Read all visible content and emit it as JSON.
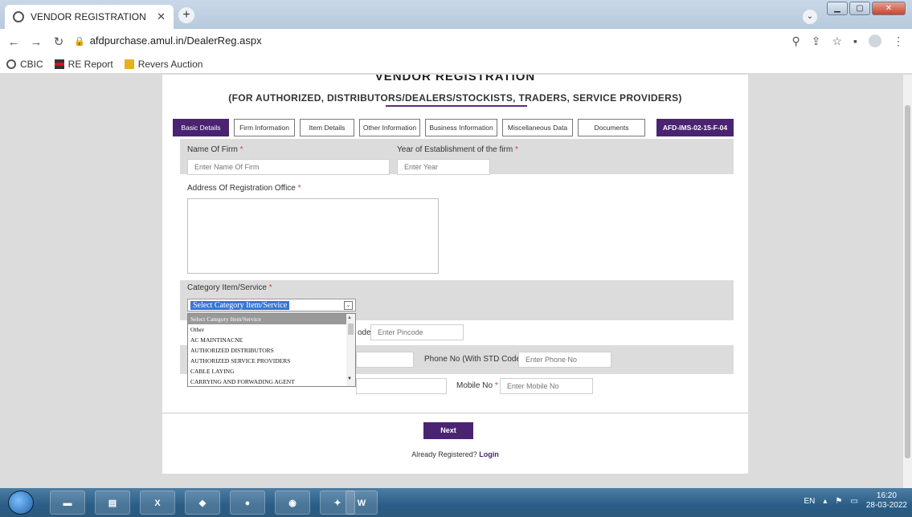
{
  "browser": {
    "tab_title": "VENDOR REGISTRATION",
    "new_tab": "+",
    "url": "afdpurchase.amul.in/DealerReg.aspx",
    "bookmarks": [
      "CBIC",
      "RE Report",
      "Revers Auction"
    ]
  },
  "page": {
    "title": "VENDOR REGISTRATION",
    "subtitle": "(FOR AUTHORIZED, DISTRIBUTORS/DEALERS/STOCKISTS, TRADERS, SERVICE PROVIDERS)",
    "tabs": [
      "Basic Details",
      "Firm Information",
      "Item Details",
      "Other Information",
      "Business Information",
      "Miscellaneous Data",
      "Documents"
    ],
    "form_code": "AFD-IMS-02-15-F-04",
    "form": {
      "name_label": "Name Of Firm",
      "name_placeholder": "Enter Name Of Firm",
      "year_label": "Year of Establishment of the firm",
      "year_placeholder": "Enter Year",
      "address_label": "Address Of Registration Office",
      "category_label": "Category Item/Service",
      "category_selected": "Select Category Item/Service",
      "category_options": [
        "Select Category Item/Service",
        "Other",
        "AC MAINTINACNE",
        "AUTHORIZED DISTRIBUTORS",
        "AUTHORIZED SERVICE PROVIDERS",
        "CABLE LAYING",
        "CARRYING AND FORWADING AGENT"
      ],
      "pincode_label_partial": "ode",
      "pincode_placeholder": "Enter Pincode",
      "phone_label": "Phone No (With STD Code)",
      "phone_placeholder": "Enter Phone No",
      "mobile_label": "Mobile No",
      "mobile_placeholder": "Enter Mobile No",
      "required_mark": "*"
    },
    "next_label": "Next",
    "already_text": "Already Registered?",
    "login_label": "Login"
  },
  "taskbar": {
    "lang": "EN",
    "time": "16:20",
    "date": "28-03-2022"
  }
}
